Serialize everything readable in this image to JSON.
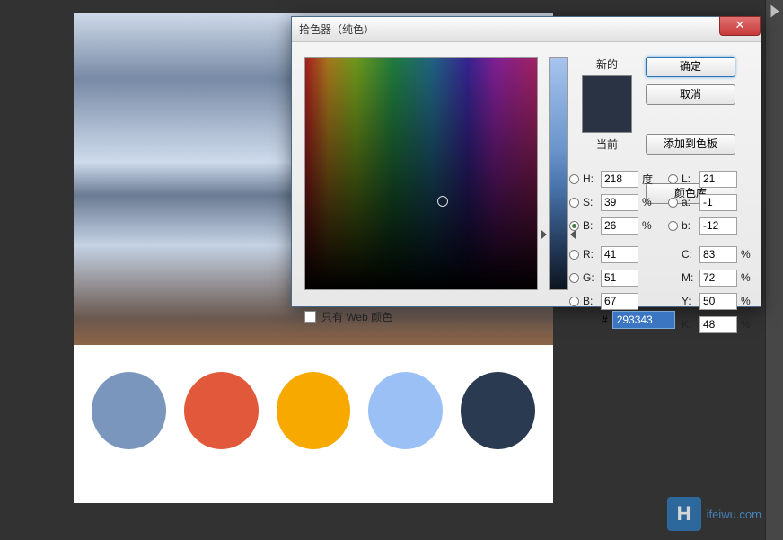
{
  "dialog": {
    "title": "拾色器（纯色）",
    "buttons": {
      "ok": "确定",
      "cancel": "取消",
      "add_swatch": "添加到色板",
      "libraries": "颜色库"
    },
    "labels": {
      "new": "新的",
      "current": "当前",
      "web_only": "只有 Web 颜色"
    },
    "preview": {
      "new_color": "#293343",
      "current_color": "#293343"
    },
    "values": {
      "H": "218",
      "H_unit": "度",
      "S": "39",
      "S_unit": "%",
      "Bv": "26",
      "Bv_unit": "%",
      "R": "41",
      "G": "51",
      "Bc": "67",
      "L": "21",
      "a": "-1",
      "b": "-12",
      "C": "83",
      "C_unit": "%",
      "M": "72",
      "M_unit": "%",
      "Y": "50",
      "Y_unit": "%",
      "K": "48",
      "K_unit": "%",
      "hex": "293343"
    },
    "selected_mode": "B"
  },
  "palette": {
    "swatches": [
      "#7a96bd",
      "#e2583b",
      "#f7a900",
      "#9ac0f6",
      "#2a3a50"
    ]
  },
  "watermark": {
    "logo": "H",
    "text": "ifeiwu.com"
  }
}
